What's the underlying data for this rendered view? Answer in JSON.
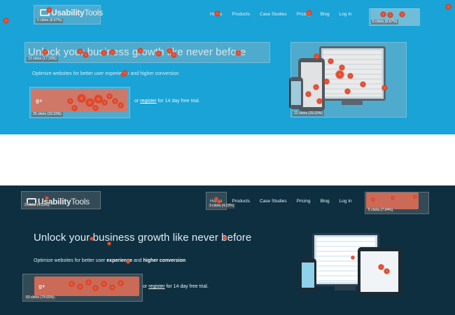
{
  "brand": {
    "name_part1": "Usability",
    "name_part2": "Tools"
  },
  "nav": {
    "items": [
      "Home",
      "Products",
      "Case Studies",
      "Pricing",
      "Blog",
      "Log In"
    ],
    "signup_label": ""
  },
  "hero": {
    "headline": "Unlock your business growth like never before",
    "subline_pre": "Optimize websites for better user",
    "subline_mid": "experience",
    "subline_and": "and",
    "subline_post": "higher conversion",
    "cta_icon": "g+",
    "register_pre": "or",
    "register_link": "register",
    "register_post": "for 14 day free trial."
  },
  "heatmap_top": {
    "logo_clicks": "5 clicks (6.67%)",
    "signup_clicks": "5 clicks (6.67%)",
    "headline_clicks": "13 clicks (17.33%)",
    "cta_clicks": "25 clicks (33.33%)",
    "devices_clicks": "22 clicks (29.33%)"
  },
  "heatmap_bottom": {
    "logo_clicks": "3 clicks (4.23%)",
    "home_clicks": "3 clicks (4.23%)",
    "signup_clicks": "5 clicks (7.04%)",
    "cta_clicks": "53 clicks (74.65%)"
  },
  "colors": {
    "top_background": "#1aa3d6",
    "bottom_background": "#0e2f3f",
    "heat_dot": "#d94027",
    "cta_button": "#d9583f"
  },
  "icons": [
    "usabilitytools-logo-mark",
    "google-plus-icon",
    "monitor-icon",
    "tablet-icon",
    "phone-icon"
  ]
}
